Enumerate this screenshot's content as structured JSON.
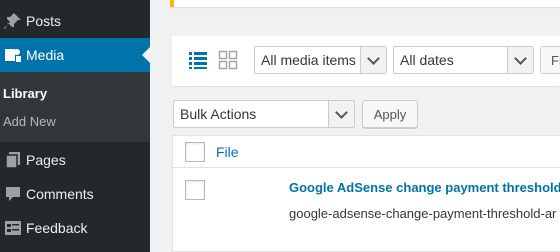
{
  "sidebar": {
    "items": [
      {
        "label": "Posts",
        "icon": "pushpin-icon"
      },
      {
        "label": "Media",
        "icon": "media-icon",
        "current": true
      },
      {
        "label": "Pages",
        "icon": "pages-icon"
      },
      {
        "label": "Comments",
        "icon": "comments-icon"
      },
      {
        "label": "Feedback",
        "icon": "feedback-icon"
      }
    ],
    "submenu": [
      {
        "label": "Library",
        "active": true
      },
      {
        "label": "Add New"
      }
    ]
  },
  "toolbar": {
    "media_filter": "All media items",
    "date_filter": "All dates",
    "filter_button": "Fi",
    "bulk_actions": "Bulk Actions",
    "apply_button": "Apply"
  },
  "table": {
    "column_file": "File",
    "rows": [
      {
        "title": "Google AdSense change payment threshold",
        "filename": "google-adsense-change-payment-threshold-ar"
      }
    ]
  },
  "colors": {
    "sidebar_bg": "#23282d",
    "accent": "#0073aa",
    "notice": "#ffb900"
  }
}
